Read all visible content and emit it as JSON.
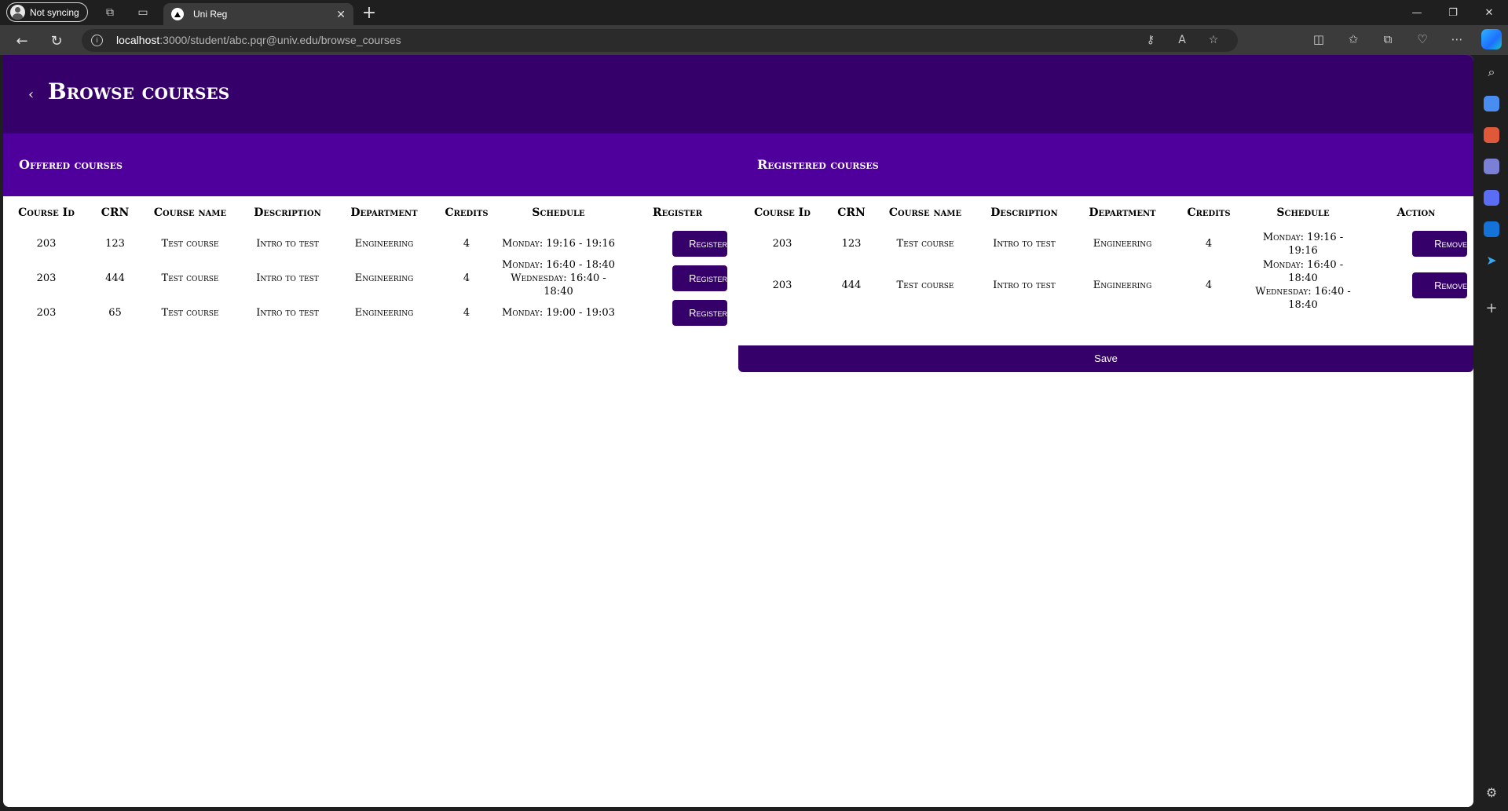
{
  "browser": {
    "profile_label": "Not syncing",
    "tab_title": "Uni Reg",
    "url_host": "localhost",
    "url_rest": ":3000/student/abc.pqr@univ.edu/browse_courses"
  },
  "page": {
    "back_symbol": "‹",
    "title": "Browse courses"
  },
  "offered": {
    "title": "Offered courses",
    "columns": [
      "Course Id",
      "CRN",
      "Course name",
      "Description",
      "Department",
      "Credits",
      "Schedule",
      "Register"
    ],
    "rows": [
      {
        "course_id": "203",
        "crn": "123",
        "name": "Test course",
        "description": "Intro to test",
        "department": "Engineering",
        "credits": "4",
        "schedule": [
          "Monday: 19:16 - 19:16"
        ],
        "action": "Register"
      },
      {
        "course_id": "203",
        "crn": "444",
        "name": "Test course",
        "description": "Intro to test",
        "department": "Engineering",
        "credits": "4",
        "schedule": [
          "Monday: 16:40 - 18:40",
          "Wednesday: 16:40 - 18:40"
        ],
        "action": "Register"
      },
      {
        "course_id": "203",
        "crn": "65",
        "name": "Test course",
        "description": "Intro to test",
        "department": "Engineering",
        "credits": "4",
        "schedule": [
          "Monday: 19:00 - 19:03"
        ],
        "action": "Register"
      }
    ]
  },
  "registered": {
    "title": "Registered courses",
    "columns": [
      "Course Id",
      "CRN",
      "Course name",
      "Description",
      "Department",
      "Credits",
      "Schedule",
      "Action"
    ],
    "rows": [
      {
        "course_id": "203",
        "crn": "123",
        "name": "Test course",
        "description": "Intro to test",
        "department": "Engineering",
        "credits": "4",
        "schedule": [
          "Monday: 19:16 - 19:16"
        ],
        "action": "Remove"
      },
      {
        "course_id": "203",
        "crn": "444",
        "name": "Test course",
        "description": "Intro to test",
        "department": "Engineering",
        "credits": "4",
        "schedule": [
          "Monday: 16:40 - 18:40",
          "Wednesday: 16:40 - 18:40"
        ],
        "action": "Remove"
      }
    ],
    "save_label": "Save"
  },
  "colors": {
    "header": "#36006b",
    "panel_header": "#4f009c",
    "button": "#36006b"
  }
}
